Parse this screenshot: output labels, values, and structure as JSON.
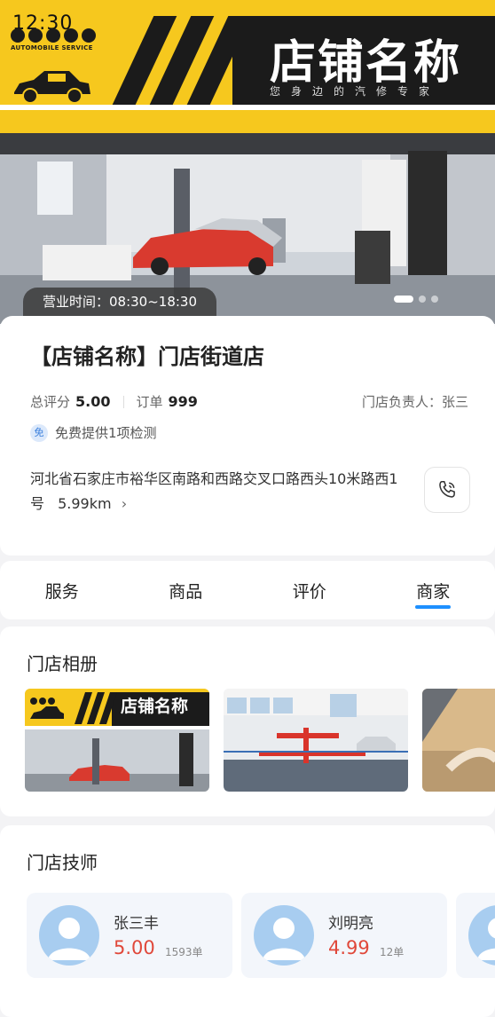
{
  "status_bar": {
    "time": "12:30"
  },
  "banner": {
    "logo_text": "AUTOMOBILE SERVICE",
    "shop_title": "店铺名称",
    "slogan": "您身边的汽修专家"
  },
  "photo": {
    "hours": "营业时间：08:30~18:30",
    "slides": 3,
    "active_slide": 1
  },
  "store": {
    "name": "【店铺名称】门店街道店",
    "rating_label": "总评分",
    "rating_value": "5.00",
    "orders_label": "订单",
    "orders_value": "999",
    "manager": "门店负责人：张三",
    "service_icon": "service-badge-icon",
    "service_text": "免费提供1项检测",
    "address": "河北省石家庄市裕华区南路和西路交叉口路西头10米路西1号",
    "distance": "5.99km"
  },
  "tabs": [
    {
      "label": "服务",
      "active": false
    },
    {
      "label": "商品",
      "active": false
    },
    {
      "label": "评价",
      "active": false
    },
    {
      "label": "商家",
      "active": true
    }
  ],
  "album": {
    "title": "门店相册",
    "thumb1_title": "店铺名称"
  },
  "technicians": {
    "title": "门店技师",
    "items": [
      {
        "name": "张三丰",
        "score": "5.00",
        "orders": "1593单"
      },
      {
        "name": "刘明亮",
        "score": "4.99",
        "orders": "12单"
      }
    ]
  },
  "colors": {
    "brand_yellow": "#f6c81e",
    "dark": "#1b1b1b",
    "accent_blue": "#1e90ff",
    "score_red": "#e0483a"
  }
}
